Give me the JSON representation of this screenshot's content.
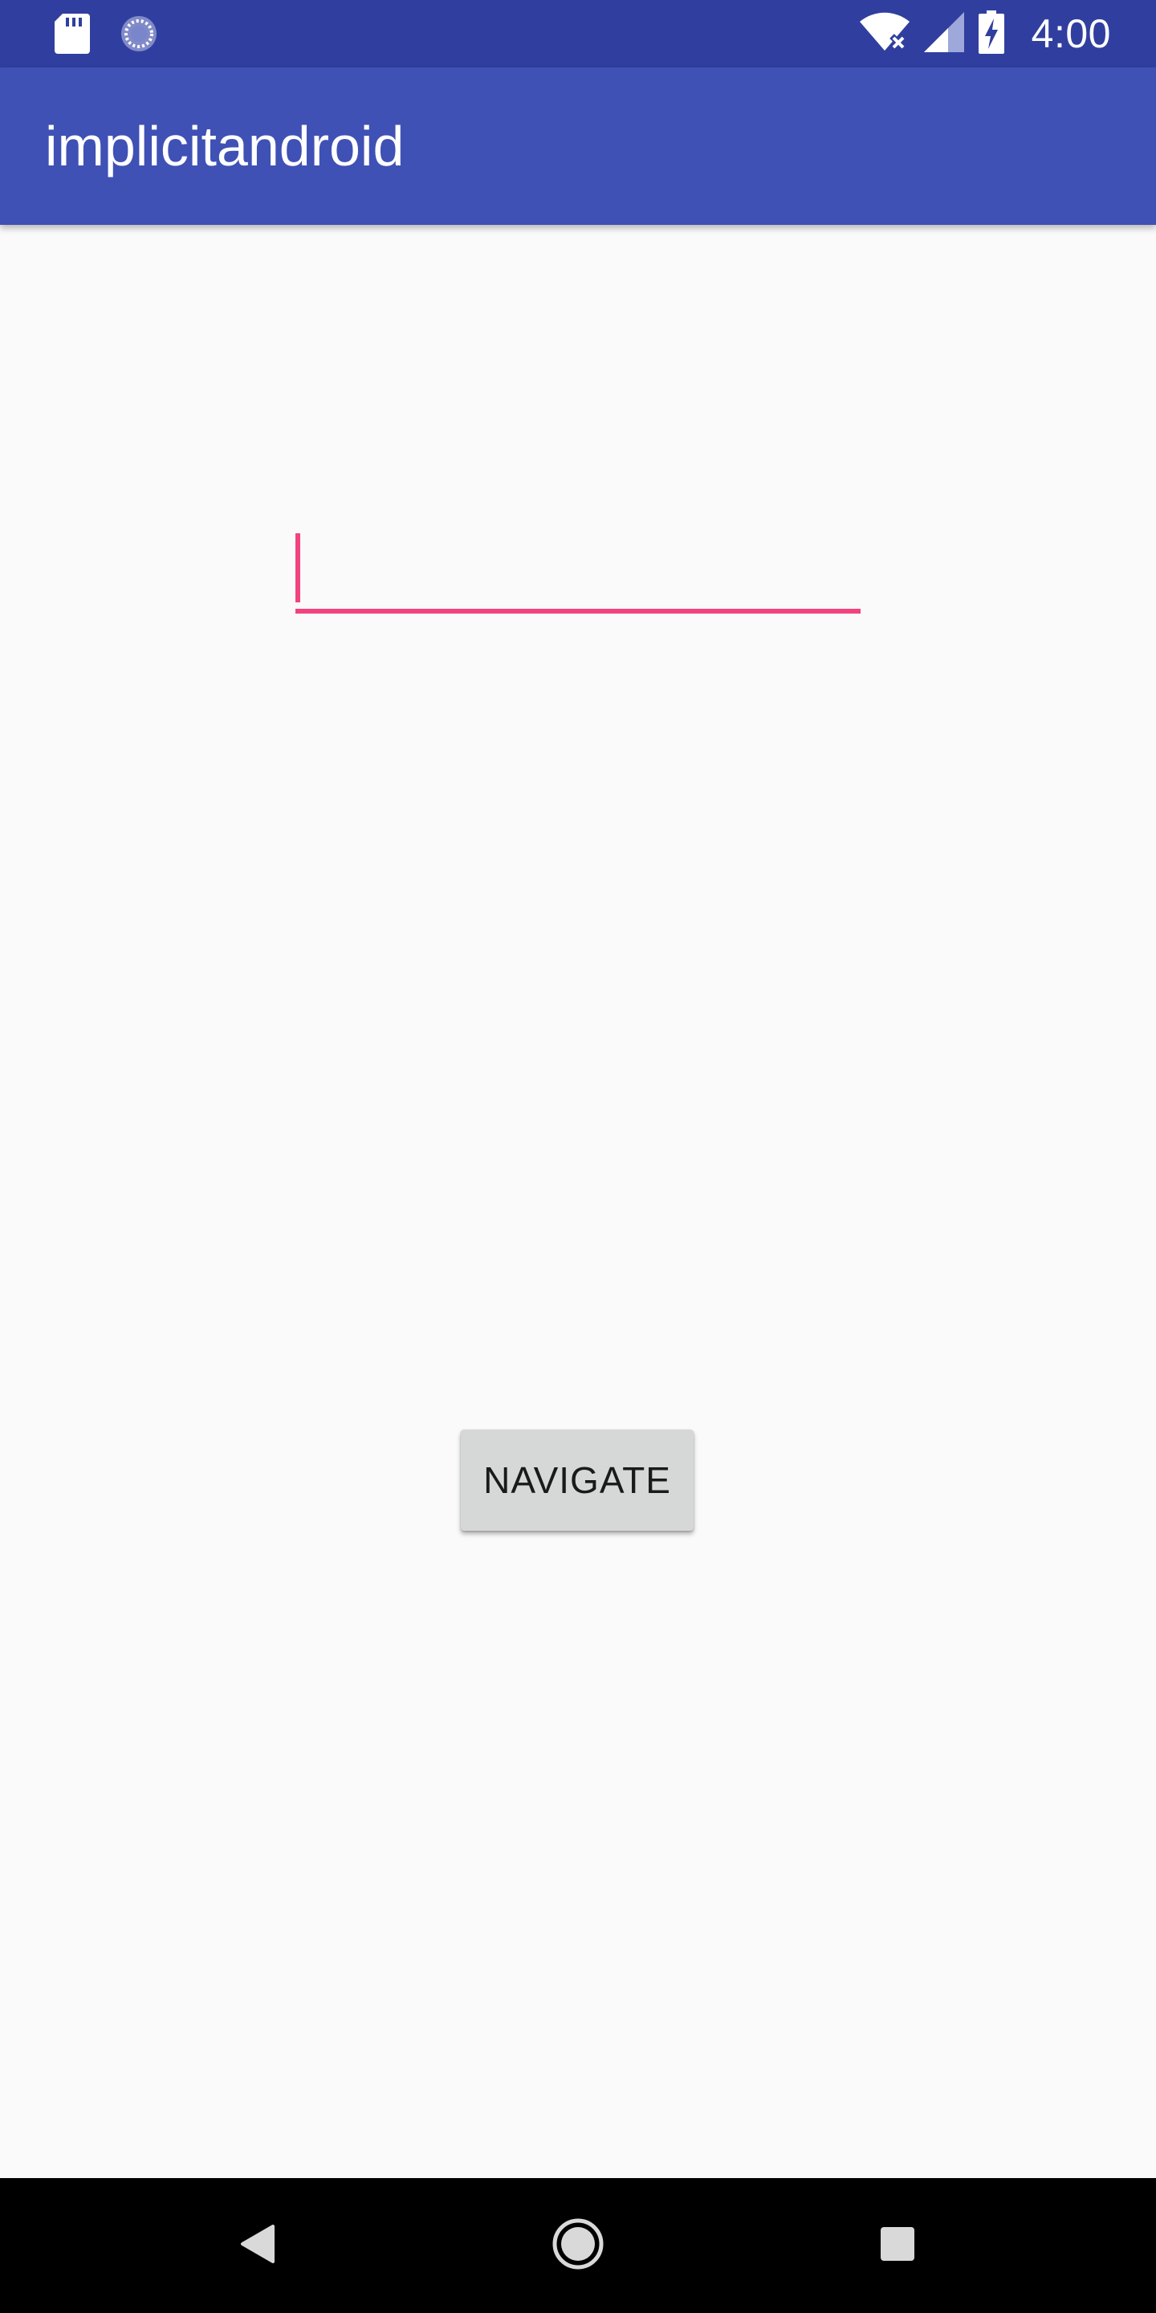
{
  "status_bar": {
    "time": "4:00",
    "icons": [
      "sd-card-icon",
      "sync-icon",
      "wifi-off-icon",
      "cell-signal-icon",
      "battery-charging-icon"
    ]
  },
  "app_bar": {
    "title": "implicitandroid"
  },
  "form": {
    "input_value": "",
    "input_placeholder": "",
    "navigate_label": "NAVIGATE"
  },
  "navigation_bar": {
    "buttons": [
      "back-icon",
      "home-icon",
      "recents-icon"
    ]
  },
  "colors": {
    "status_bar": "#303f9f",
    "app_bar": "#3f51b5",
    "accent": "#f1437f",
    "background": "#fafafa",
    "button": "#d6d7d7",
    "nav_bar": "#000000"
  }
}
